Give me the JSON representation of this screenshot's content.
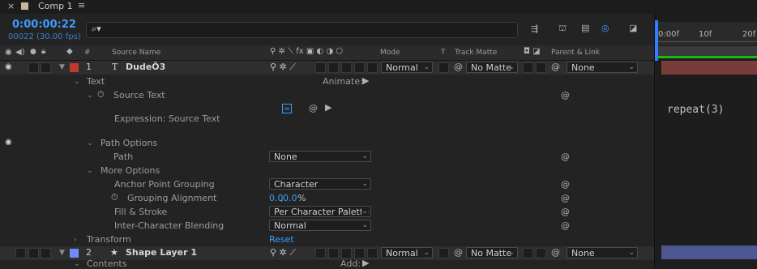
{
  "tab": {
    "title": "Comp 1"
  },
  "header": {
    "timecode": "0:00:00:22",
    "frames": "00022 (30.00 fps)",
    "search_placeholder": ""
  },
  "columns": {
    "num": "#",
    "source_name": "Source Name",
    "mode": "Mode",
    "t": "T",
    "track_matte": "Track Matte",
    "parent_link": "Parent & Link"
  },
  "timeline": {
    "ruler": [
      "0:00f",
      "10f",
      "20f"
    ],
    "expression_text": "repeat(3)"
  },
  "layers": [
    {
      "index": "1",
      "name": "DudeÖ3",
      "type_icon": "T",
      "mode": "Normal",
      "matte": "No Matte",
      "parent": "None",
      "color": "#c0392b"
    },
    {
      "index": "2",
      "name": "Shape Layer 1",
      "type_icon": "★",
      "mode": "Normal",
      "matte": "No Matte",
      "parent": "None",
      "color": "#6b8cff"
    }
  ],
  "props": {
    "text": "Text",
    "animate": "Animate:",
    "source_text": "Source Text",
    "expression": "Expression: Source Text",
    "path_options": "Path Options",
    "path": "Path",
    "path_value": "None",
    "more_options": "More Options",
    "anchor_grouping": "Anchor Point Grouping",
    "anchor_value": "Character",
    "grouping_alignment": "Grouping Alignment",
    "ga_x": "0.0",
    "ga_y": "0.0",
    "ga_unit": "%",
    "fill_stroke": "Fill & Stroke",
    "fill_value": "Per Character Palette",
    "inter_blend": "Inter-Character Blending",
    "blend_value": "Normal",
    "transform": "Transform",
    "reset": "Reset",
    "contents": "Contents",
    "add": "Add:"
  }
}
